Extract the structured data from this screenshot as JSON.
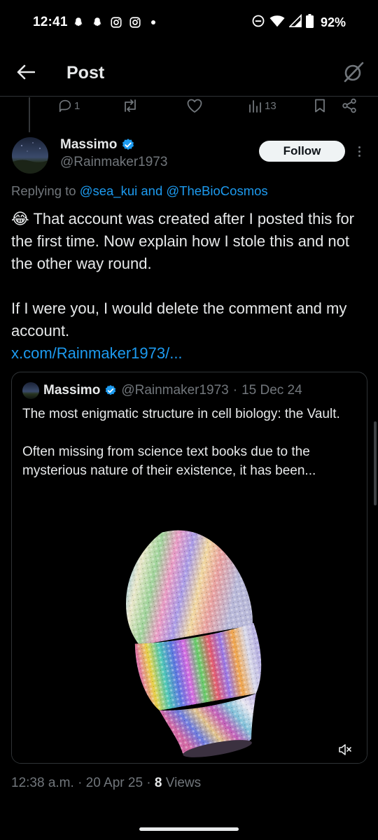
{
  "status_bar": {
    "time": "12:41",
    "battery": "92%",
    "notification_icons": [
      "snapchat-icon",
      "snapchat-icon",
      "instagram-icon",
      "instagram-icon"
    ]
  },
  "header": {
    "title": "Post"
  },
  "parent_actions": {
    "replies": "1",
    "reposts": "",
    "likes": "",
    "views": "13"
  },
  "reply": {
    "name": "Massimo",
    "handle": "@Rainmaker1973",
    "follow_label": "Follow",
    "replying_prefix": "Replying to",
    "replying_mentions": "@sea_kui and @TheBioCosmos",
    "emoji": "😂",
    "paragraph1": "That account was created after I posted this for the first time. Now explain how I stole this and not the other way round.",
    "paragraph2": "If I were you, I would delete the comment and my account.",
    "link": "x.com/Rainmaker1973/..."
  },
  "quote": {
    "name": "Massimo",
    "handle": "@Rainmaker1973",
    "date": "15 Dec 24",
    "text1": "The most enigmatic structure in cell biology: the Vault.",
    "text2": "Often missing from science text books due to the mysterious nature of their existence, it has been..."
  },
  "meta": {
    "time": "12:38 a.m.",
    "date": "20 Apr 25",
    "views_count": "8",
    "views_label": "Views"
  },
  "colors": {
    "background": "#000000",
    "accent": "#1d9bf0",
    "secondary_text": "#71767b",
    "primary_text": "#e7e9ea",
    "border": "#2f3336"
  }
}
